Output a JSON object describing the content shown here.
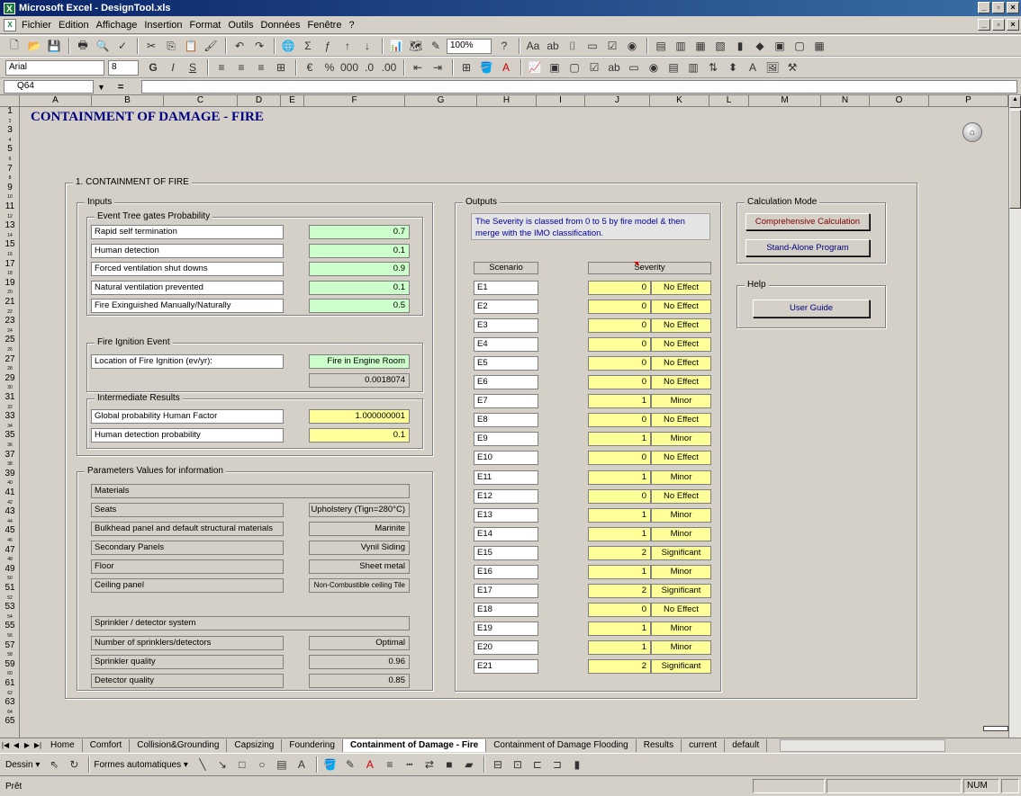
{
  "window": {
    "title": "Microsoft Excel - DesignTool.xls",
    "app_icon": "X"
  },
  "menu": [
    "Fichier",
    "Edition",
    "Affichage",
    "Insertion",
    "Format",
    "Outils",
    "Données",
    "Fenêtre",
    "?"
  ],
  "toolbar": {
    "zoom": "100%",
    "font": "Arial",
    "size": "8"
  },
  "formula": {
    "cell_ref": "Q64",
    "fx": "="
  },
  "columns": [
    "A",
    "B",
    "C",
    "D",
    "E",
    "F",
    "G",
    "H",
    "I",
    "J",
    "K",
    "L",
    "M",
    "N",
    "O",
    "P"
  ],
  "rows": [
    "1",
    "2",
    "3",
    "4",
    "5",
    "6",
    "7",
    "8",
    "9",
    "10",
    "11",
    "12",
    "13",
    "14",
    "15",
    "16",
    "17",
    "18",
    "19",
    "20",
    "21",
    "22",
    "23",
    "24",
    "25",
    "26",
    "27",
    "28",
    "29",
    "30",
    "31",
    "32",
    "33",
    "34",
    "35",
    "36",
    "37",
    "38",
    "39",
    "40",
    "41",
    "42",
    "43",
    "44",
    "45",
    "46",
    "47",
    "48",
    "49",
    "50",
    "51",
    "52",
    "53",
    "54",
    "55",
    "56",
    "57",
    "58",
    "59",
    "60",
    "61",
    "62",
    "63",
    "64",
    "65"
  ],
  "sheet": {
    "title": "CONTAINMENT OF DAMAGE - FIRE",
    "section": "1. CONTAINMENT OF FIRE",
    "inputs": {
      "label": "Inputs",
      "event_tree": {
        "label": "Event Tree gates Probability",
        "rows": [
          {
            "label": "Rapid self termination",
            "value": "0.7"
          },
          {
            "label": "Human detection",
            "value": "0.1"
          },
          {
            "label": "Forced ventilation shut downs",
            "value": "0.9"
          },
          {
            "label": "Natural ventilation prevented",
            "value": "0.1"
          },
          {
            "label": "Fire Exinguished Manually/Naturally",
            "value": "0.5"
          }
        ]
      },
      "ignition": {
        "label": "Fire Ignition Event",
        "location_label": "Location of Fire Ignition (ev/yr):",
        "location_value": "Fire in Engine Room",
        "frequency": "0.0018074"
      },
      "intermediate": {
        "label": "Intermediate Results",
        "rows": [
          {
            "label": "Global probability Human Factor",
            "value": "1.000000001"
          },
          {
            "label": "Human detection probability",
            "value": "0.1"
          }
        ]
      }
    },
    "params": {
      "label": "Parameters Values for information",
      "materials_header": "Materials",
      "materials": [
        {
          "label": "Seats",
          "value": "Upholstery (Tign=280°C)"
        },
        {
          "label": "Bulkhead panel and default structural materials",
          "value": "Marinite"
        },
        {
          "label": "Secondary Panels",
          "value": "Vynil Siding"
        },
        {
          "label": "Floor",
          "value": "Sheet metal"
        },
        {
          "label": "Ceiling panel",
          "value": "Non-Combustible ceiling Tile"
        }
      ],
      "sprinkler_header": "Sprinkler / detector system",
      "sprinkler": [
        {
          "label": "Number of sprinklers/detectors",
          "value": "Optimal"
        },
        {
          "label": "Sprinkler quality",
          "value": "0.96"
        },
        {
          "label": "Detector quality",
          "value": "0.85"
        }
      ]
    },
    "outputs": {
      "label": "Outputs",
      "note": "The Severity is classed from 0 to 5 by fire model & then merge with the IMO classification.",
      "col_scenario": "Scenario",
      "col_severity": "Severity",
      "rows": [
        {
          "s": "E1",
          "v": "0",
          "c": "No Effect"
        },
        {
          "s": "E2",
          "v": "0",
          "c": "No Effect"
        },
        {
          "s": "E3",
          "v": "0",
          "c": "No Effect"
        },
        {
          "s": "E4",
          "v": "0",
          "c": "No Effect"
        },
        {
          "s": "E5",
          "v": "0",
          "c": "No Effect"
        },
        {
          "s": "E6",
          "v": "0",
          "c": "No Effect"
        },
        {
          "s": "E7",
          "v": "1",
          "c": "Minor"
        },
        {
          "s": "E8",
          "v": "0",
          "c": "No Effect"
        },
        {
          "s": "E9",
          "v": "1",
          "c": "Minor"
        },
        {
          "s": "E10",
          "v": "0",
          "c": "No Effect"
        },
        {
          "s": "E11",
          "v": "1",
          "c": "Minor"
        },
        {
          "s": "E12",
          "v": "0",
          "c": "No Effect"
        },
        {
          "s": "E13",
          "v": "1",
          "c": "Minor"
        },
        {
          "s": "E14",
          "v": "1",
          "c": "Minor"
        },
        {
          "s": "E15",
          "v": "2",
          "c": "Significant"
        },
        {
          "s": "E16",
          "v": "1",
          "c": "Minor"
        },
        {
          "s": "E17",
          "v": "2",
          "c": "Significant"
        },
        {
          "s": "E18",
          "v": "0",
          "c": "No Effect"
        },
        {
          "s": "E19",
          "v": "1",
          "c": "Minor"
        },
        {
          "s": "E20",
          "v": "1",
          "c": "Minor"
        },
        {
          "s": "E21",
          "v": "2",
          "c": "Significant"
        }
      ]
    },
    "calc_mode": {
      "label": "Calculation Mode",
      "btn_comprehensive": "Comprehensive Calculation",
      "btn_standalone": "Stand-Alone Program"
    },
    "help": {
      "label": "Help",
      "btn_guide": "User Guide"
    }
  },
  "tabs": [
    "Home",
    "Comfort",
    "Collision&Grounding",
    "Capsizing",
    "Foundering",
    "Containment of Damage - Fire",
    "Containment of Damage Flooding",
    "Results",
    "current",
    "default"
  ],
  "active_tab": "Containment of Damage - Fire",
  "drawbar": {
    "draw": "Dessin ▾",
    "shapes": "Formes automatiques ▾"
  },
  "status": {
    "ready": "Prêt",
    "num": "NUM"
  }
}
